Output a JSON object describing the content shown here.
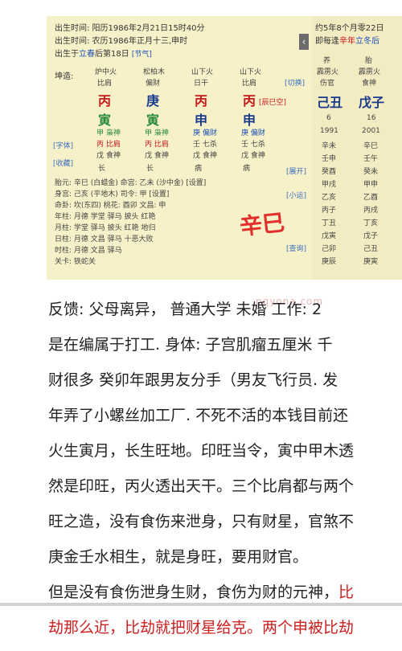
{
  "header": {
    "birth_time_solar": "出生时间: 阳历1986年2月21日15时40分",
    "birth_time_lunar": "出生时间: 农历1986年正月十三,申时",
    "born_after": "出生于",
    "solar_term": "立春",
    "after_days": "后第18日",
    "tag_jieqi": "[节气]"
  },
  "chart_grid": {
    "row_label": "坤造:",
    "nayin": [
      "炉中火",
      "松柏木",
      "山下火",
      "山下火"
    ],
    "tengshen": [
      "比肩",
      "偏财",
      "日干",
      "比肩"
    ],
    "stems": [
      "丙",
      "庚",
      "丙",
      "丙"
    ],
    "stem_note": "[辰巳空]",
    "branches": [
      "寅",
      "寅",
      "申",
      "申"
    ],
    "hidden_1": [
      "甲 枭神",
      "甲 枭神",
      "庚 偏财",
      "庚 偏财"
    ],
    "hidden_2": [
      "丙 比肩",
      "丙 比肩",
      "壬 七杀",
      "壬 七杀"
    ],
    "hidden_3": [
      "戊 食神",
      "戊 食神",
      "戊 食神",
      "戊 食神"
    ],
    "stage": [
      "长",
      "长",
      "病",
      "病"
    ],
    "side_tags": {
      "qiehuan": "[切换]",
      "zhi": "[字体]",
      "shoucang": "[收藏]",
      "zhankai": "[展开]",
      "xiaoyun": "[小运]",
      "chakan": "[查询]"
    },
    "tai_yuan": "胎元: 辛巳 (白蜡金)  命宫: 乙未 (沙中金) [设置]",
    "shen_gong": "身宫: 己亥 (平地木)  司令: 甲 [设置]",
    "ming_gua": "命卦: 坎(东四) 桃花: 酉卯  文昌: 申",
    "nian_zhu": "年柱: 月德 学堂 驿马 披头 红艳",
    "yue_zhu": "月柱: 学堂 驿马 披头 红艳 地归",
    "ri_zhu": "日柱: 月德 文昌 驿马 十恶大败",
    "shi_zhu": "时柱: 月德 文昌 驿马",
    "guan_sha": "关卡: 铁蛇关",
    "big_stamp": "辛巳"
  },
  "dayun": {
    "start_info": "约5年8个月零22日",
    "start_detail_prefix": "即每逢",
    "start_highlight_1": "辛年",
    "start_highlight_2": "立冬后",
    "col_top": [
      "养",
      "胎"
    ],
    "nayin": [
      "霹雳火",
      "霹雳火"
    ],
    "tengshen": [
      "伤官",
      "食神"
    ],
    "ganzhi": [
      "己丑",
      "戊子"
    ],
    "ages": [
      "6",
      "16"
    ],
    "years": [
      "1991",
      "2001"
    ],
    "liunian_1": [
      "辛未",
      "壬申",
      "癸酉",
      "甲戌",
      "乙亥",
      "丙子",
      "丁丑",
      "戊寅",
      "己卯",
      "庚辰"
    ],
    "liunian_2": [
      "辛巳",
      "壬午",
      "癸未",
      "甲申",
      "乙酉",
      "丙戌",
      "丁亥",
      "戊子",
      "己丑",
      "庚寅"
    ]
  },
  "watermark": "pqyona.com",
  "article": {
    "p1_line1": "反馈: 父母离异，  普通大学  未婚  工作:    2",
    "p1_line2": "是在编属于打工.  身体:    子宫肌瘤五厘米  千",
    "p1_line3": "财很多    癸卯年跟男友分手（男友飞行员. 发",
    "p1_line4": "年弄了小螺丝加工厂. 不死不活的本钱目前还",
    "p2_line1": "火生寅月，长生旺地。印旺当令，寅中甲木透",
    "p2_line2": "然是印旺，丙火透出天干。三个比肩都与两个",
    "p2_line3": "旺之造，没有食伤来泄身，只有财星，官煞不",
    "p2_line4": "庚金壬水相生，就是身旺，要用财官。",
    "p3_line1_a": "但是没有食伤泄身生财，食伤为财的元神，",
    "p3_line1_b": "比",
    "p3_line2": "劫那么近，比劫就把财星给克。两个申被比劫"
  },
  "colors": {
    "stem_red": "#c8171b",
    "stem_blue": "#1a4fb8",
    "stamp": "#e3302c",
    "highlight": "#cc1f1f"
  }
}
